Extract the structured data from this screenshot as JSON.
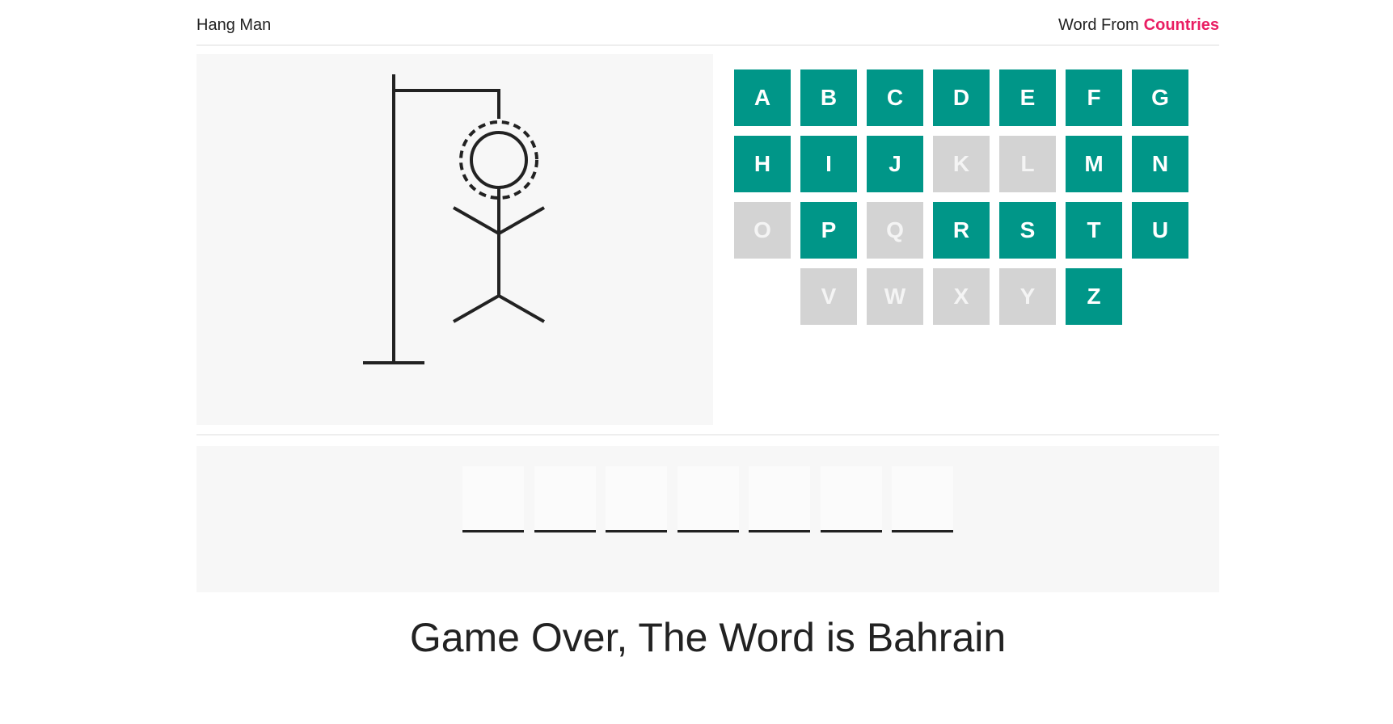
{
  "header": {
    "title": "Hang Man",
    "category_prefix": "Word From",
    "category_name": "Countries"
  },
  "colors": {
    "accent": "#009688",
    "used_key": "#d3d3d3",
    "category": "#e91e63",
    "panel": "#f7f7f7"
  },
  "keyboard": {
    "rows": [
      [
        {
          "letter": "A",
          "state": "available"
        },
        {
          "letter": "B",
          "state": "available"
        },
        {
          "letter": "C",
          "state": "available"
        },
        {
          "letter": "D",
          "state": "available"
        },
        {
          "letter": "E",
          "state": "available"
        },
        {
          "letter": "F",
          "state": "available"
        },
        {
          "letter": "G",
          "state": "available"
        }
      ],
      [
        {
          "letter": "H",
          "state": "available"
        },
        {
          "letter": "I",
          "state": "available"
        },
        {
          "letter": "J",
          "state": "available"
        },
        {
          "letter": "K",
          "state": "used"
        },
        {
          "letter": "L",
          "state": "used"
        },
        {
          "letter": "M",
          "state": "available"
        },
        {
          "letter": "N",
          "state": "available"
        }
      ],
      [
        {
          "letter": "O",
          "state": "used"
        },
        {
          "letter": "P",
          "state": "available"
        },
        {
          "letter": "Q",
          "state": "used"
        },
        {
          "letter": "R",
          "state": "available"
        },
        {
          "letter": "S",
          "state": "available"
        },
        {
          "letter": "T",
          "state": "available"
        },
        {
          "letter": "U",
          "state": "available"
        }
      ],
      [
        {
          "letter": "V",
          "state": "used"
        },
        {
          "letter": "W",
          "state": "used"
        },
        {
          "letter": "X",
          "state": "used"
        },
        {
          "letter": "Y",
          "state": "used"
        },
        {
          "letter": "Z",
          "state": "available"
        }
      ]
    ]
  },
  "word": {
    "slots": [
      "",
      "",
      "",
      "",
      "",
      "",
      ""
    ]
  },
  "result": {
    "message": "Game Over, The Word is Bahrain"
  }
}
